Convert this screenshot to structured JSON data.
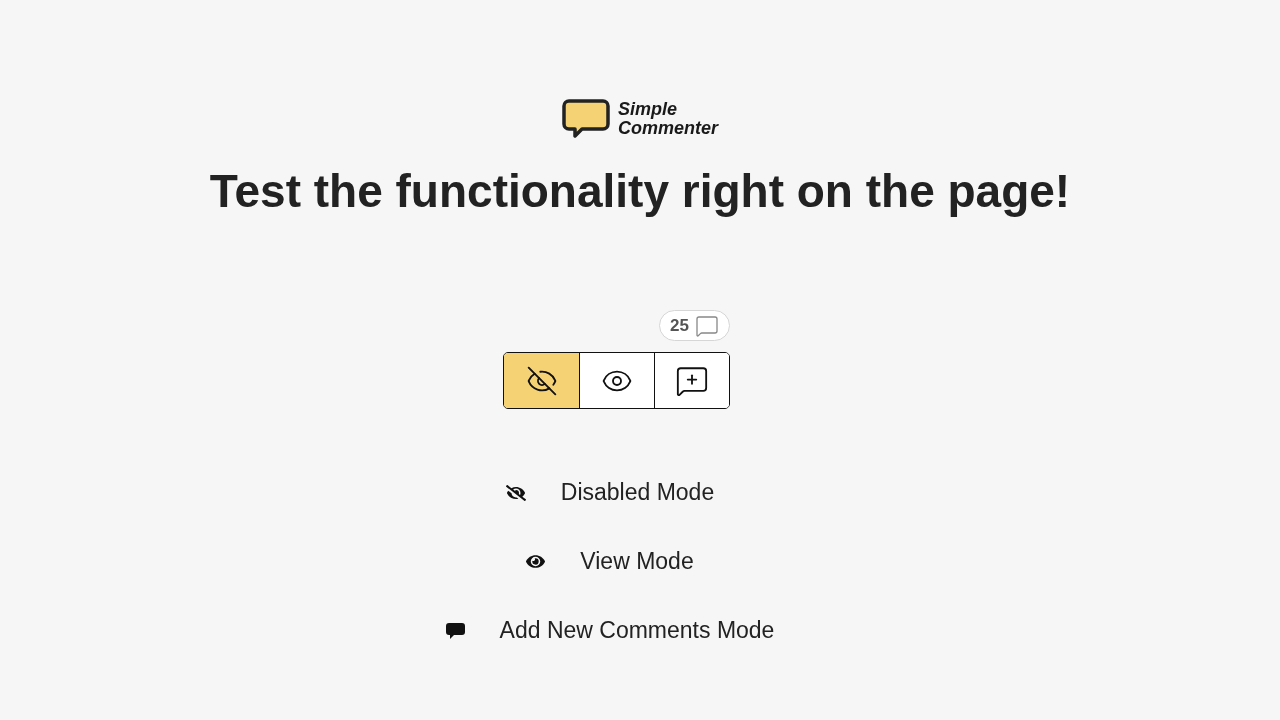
{
  "logo": {
    "line_1": "Simple",
    "line_2": "Commenter"
  },
  "heading": "Test the functionality right on the page!",
  "comment_count": "25",
  "mode_buttons": [
    {
      "kind": "disabled",
      "selected": true
    },
    {
      "kind": "view",
      "selected": false
    },
    {
      "kind": "add",
      "selected": false
    }
  ],
  "legend": [
    {
      "kind": "disabled",
      "label": "Disabled Mode"
    },
    {
      "kind": "view",
      "label": "View Mode"
    },
    {
      "kind": "add",
      "label": "Add New Comments Mode"
    }
  ]
}
